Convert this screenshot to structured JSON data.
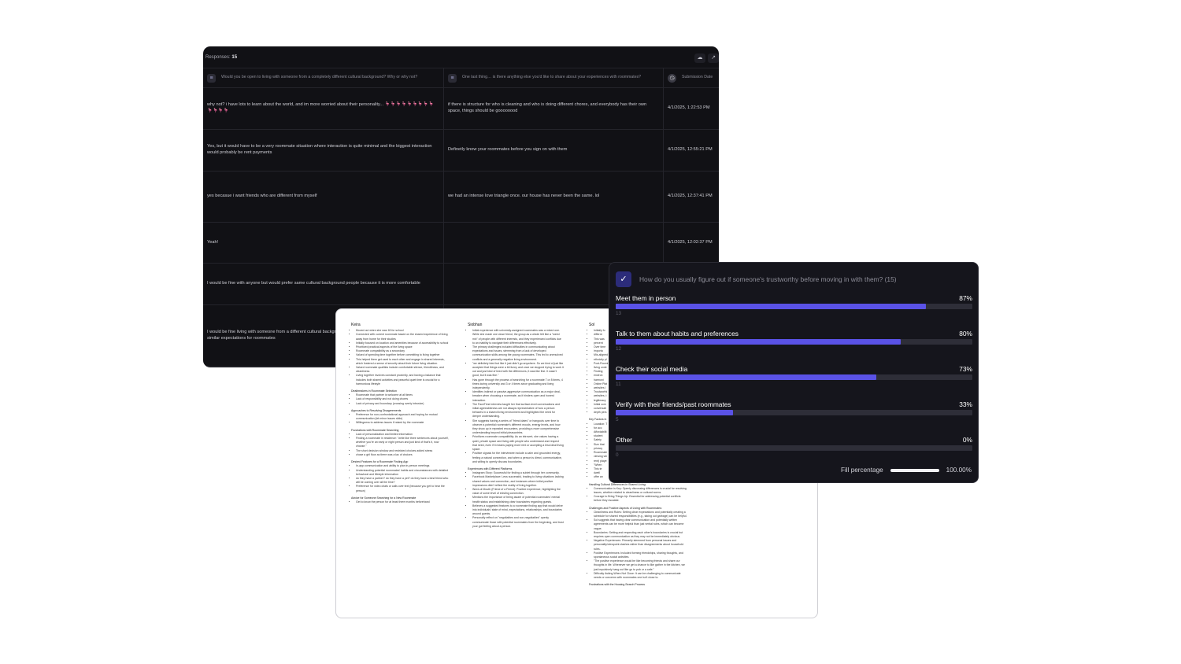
{
  "table": {
    "responses_label": "Responses:",
    "responses_count": "15",
    "icons": {
      "cloud": "cloud-icon",
      "share": "share-icon"
    },
    "columns": [
      "Would you be open to living with someone from a completely different cultural background? Why or why not?",
      "One last thing… is there anything else you'd like to share about your experiences with roommates?",
      "Submission Date"
    ],
    "rows": [
      {
        "answer1": "why not? i have lots to learn about the world, and im more worried about their personality... 🦩🦩🦩🦩🦩🦩🦩🦩🦩🦩🦩🦩🦩",
        "answer2": "if there is structure for who is cleaning and who is doing different chores, and everybody has their own space, things should be goooooood",
        "date": "4/1/2025, 1:22:53 PM"
      },
      {
        "answer1": "Yes, but it would have to be a very roommate situation where interaction is quite minimal and the biggest interaction would probably be rent payments",
        "answer2": "Definetly know your roommates before you sign on with them",
        "date": "4/1/2025, 12:55:21 PM"
      },
      {
        "answer1": "yes becasue i want friends who are different from myself",
        "answer2": "we had an intense love triangle once. our house has never been the same. lol",
        "date": "4/1/2025, 12:37:41 PM"
      },
      {
        "answer1": "Yeah!",
        "answer2": "",
        "date": "4/1/2025, 12:02:37 PM"
      },
      {
        "answer1": "I would be fine with anyone but would prefer same cultural background people because it is more comfortable",
        "answer2": "",
        "date": ""
      },
      {
        "answer1": "I would be fine living with someone from a different cultural background if they speak the same language(s) and have similar expectations for roommates",
        "answer2": "",
        "date": ""
      }
    ]
  },
  "doc": {
    "col1": {
      "title": "Keira",
      "bullets": [
        "Moved out when she was 18 for school",
        "Connected with current roommate based on the shared experience of living away from home for their studies",
        "Initially focused on location and amenities because of accessibility to school",
        "Prioritized practical aspects of the living space",
        "Roommate compatibility as a secondary",
        "Valued of spending time together before committing to living together",
        "This helped them get used to each other and engage in shared interests, which fostered a sense of security about their future living situation.",
        "Valued roommate qualities include comfortable silence, friendliness, and cleanliness",
        "Living together involves constant proximity, and having a balance that includes both shared activities and peaceful quiet time is crucial for a harmonious lifestyle"
      ],
      "sections": [
        {
          "heading": "Dealbreakers in Roommate Selection",
          "bullets": [
            "Roommate that partner is welcome at all times",
            "Lack of responsibility and not doing chores",
            "Lack of privacy and boundary (crossing overly intrusive)"
          ]
        },
        {
          "heading": "Approaches to Resolving Disagreements",
          "bullets": [
            "Preference for non-confrontational approach and hoping for mutual communication (let minor issues slide)",
            "Willingness to address issues if raised by the roommate"
          ]
        },
        {
          "heading": "Frustrations with Roommate Searching",
          "bullets": [
            "Lack of personalization and limited information",
            "Finding a roommate in residence: \"write like three sentences about yourself, whether you're an early or night person and just kind of that's it, now choose.\"",
            "The short decision window and restricted choices added stress",
            "chose a girl floor as there was a lac of choices"
          ]
        },
        {
          "heading": "Desired Features for a Roommate Finding App",
          "bullets": [
            "In-app communication and ability to plan in-person meetings",
            "Understanding potential roommates' habits and circumstances with detailed behavioral and lifestyle information",
            "do they have a partner? do they have a pet? do they have a best friend who will be coming over all the time?",
            "Preference for video chats or calls over text (because you get to hear the person)"
          ]
        },
        {
          "heading": "Advice for Someone Searching for a New Roommate",
          "bullets": [
            "Get to know the person for at least three months beforehand"
          ]
        }
      ]
    },
    "col2": {
      "title": "Siobhan",
      "bullets": [
        "Initial experience with university-assigned roommates was a mixed one. While she made one close friend, the group as a whole felt like a \"weird mix\" of people with different interests, and they experienced conflicts due to an inability to navigate their differences effectively.",
        "The primary challenges included difficulties in communicating about expectations and issues, stemming from a lack of developed communication skills among the young roommates. This led to unresolved conflicts and a generally negative living environment.",
        "\"we definitely tried but like it just didn't go anywhere. So we kind of just like accepted that things were a bit funny and once we stopped trying to work it out and just kind of lived with the differences, it was like fine. It wasn't good, but it was fine.\"",
        "Has gone through the process of searching for a roommate 7 or 8 times, 4 times during university and 3 or 4 times since graduating and living independently.",
        "Identifies indirect or passive-aggressive communication as a major deal-breaker when choosing a roommate, as it hinders open and honest interaction.",
        "The FaceTime interview taught her that surface-level conversations and initial agreeableness are not always representative of how a person behaves in a shared living environment and highlighted the need for deeper understanding.",
        "She suggests having a series of \"friend dates\" or hangouts over time to observe a potential roommate's different moods, energy levels, and how they show up in repeated encounters, providing a more comprehensive understanding beyond initial pleasantries.",
        "Prioritizes roommate compatibility. As an introvert, she values having a quiet, private space and living with people who understand and respect that need, even if it means paying more rent or accepting a less ideal living space.",
        "Positive signals for the interviewee include a calm and grounded energy, feeling a natural connection, and when a person is direct, communicative, and willing to openly discuss boundaries."
      ],
      "sections": [
        {
          "heading": "Experiences with Different Platforms",
          "bullets": [
            "Instagram Story: Successful for finding a sublet through her community.",
            "Facebook Marketplace: Less successful, leading to living situations lacking shared values and connection, and instances where initial positive impressions didn't reflect the reality of living together.",
            "Word-of-Mouth (Friend of a Friend): Positive experience, highlighting the value of some level of existing connection.",
            "Mentions the importance of being aware of potential roommates' mental health status and establishing clear boundaries regarding guests.",
            "Believes a suggested features to a roommate finding app that would delve into individuals' state of mind, expectations, relationships, and boundaries around guests.",
            "Personally reflect on \"negotiables and non-negotiables\" openly communicate those with potential roommates from the beginning, and trust your gut feeling about a person."
          ]
        }
      ]
    },
    "col3": {
      "title": "Sol",
      "bullets": [
        "Initially fo",
        "differnt",
        "This was",
        "percent",
        "Over time",
        "importa",
        "Mis-aligned",
        "ethnicity pl",
        "Post-Roomi",
        "living unde",
        "Finding",
        "environ",
        "harmoni",
        "Online Plat",
        "websites l",
        "Trustworthi",
        "websites, t",
        "legitimacy",
        "Initial com",
        "conversati",
        "depth pers"
      ],
      "sections": [
        {
          "heading": "Key Factors in",
          "bullets": [
            "Location: T",
            "for acc",
            "Affordabilit",
            "student",
            "Safety",
            "Size that",
            "privacy",
            "Roommate",
            "viewing wh",
            "rent) playe",
            "\"When",
            "This te",
            "dwell",
            "offer an"
          ]
        },
        {
          "heading": "Handling Cultural Differences in Shared Living:",
          "bullets": [
            "Communication is Key: Openly discussing differences is crucial for resolving issues, whether related to cleanliness or cultural norms.",
            "Courage to Bring Things Up: Essential for addressing potential conflicts before they escalate."
          ]
        },
        {
          "heading": "Challenges and Positive Aspects of Living with Roommates:",
          "bullets": [
            "Cleanliness and Rules: Setting clear expectations and potentially creating a schedule for shared responsibilities (e.g., taking out garbage) can be helpful.",
            "Sol suggests that having clear communication and potentially written agreements can be more helpful than just verbal rules, which can become vague.",
            "Boundaries: Setting and respecting each other's boundaries is crucial but requires open communication as they may not be immediately obvious.",
            "Negative Experiences: Primarily stemmed from personal issues and personality/viewpoint clashes rather than disagreements about household rules.",
            "Positive Experiences: Included forming friendships, sharing thoughts, and spontaneous social activities.",
            "\"The positive experience would be like becoming friends and share our thoughts in life. Whenever we get a chance to like gather in the kitchen, we just impulsively hang out like go to pub or a cafe.\"",
            "Difficulty Asking When Not Close: It can be challenging to communicate needs or concerns with roommates one isn't close to."
          ]
        },
        {
          "heading": "Frustrations with the Housing Search Process",
          "bullets": []
        }
      ]
    }
  },
  "poll": {
    "question": "How do you usually figure out if someone's trustworthy before moving in with them? (15)",
    "check_icon": "checkmark-icon",
    "accent": "#5a52e6",
    "options": [
      {
        "label": "Meet them in person",
        "percent": 87,
        "percent_label": "87%",
        "count": "13"
      },
      {
        "label": "Talk to them about habits and preferences",
        "percent": 80,
        "percent_label": "80%",
        "count": "12"
      },
      {
        "label": "Check their social media",
        "percent": 73,
        "percent_label": "73%",
        "count": "11"
      },
      {
        "label": "Verify with their friends/past roommates",
        "percent": 33,
        "percent_label": "33%",
        "count": "5"
      },
      {
        "label": "Other",
        "percent": 0,
        "percent_label": "0%",
        "count": "0"
      }
    ],
    "fill_label": "Fill percentage",
    "fill_value": 100,
    "fill_value_label": "100.00%"
  }
}
